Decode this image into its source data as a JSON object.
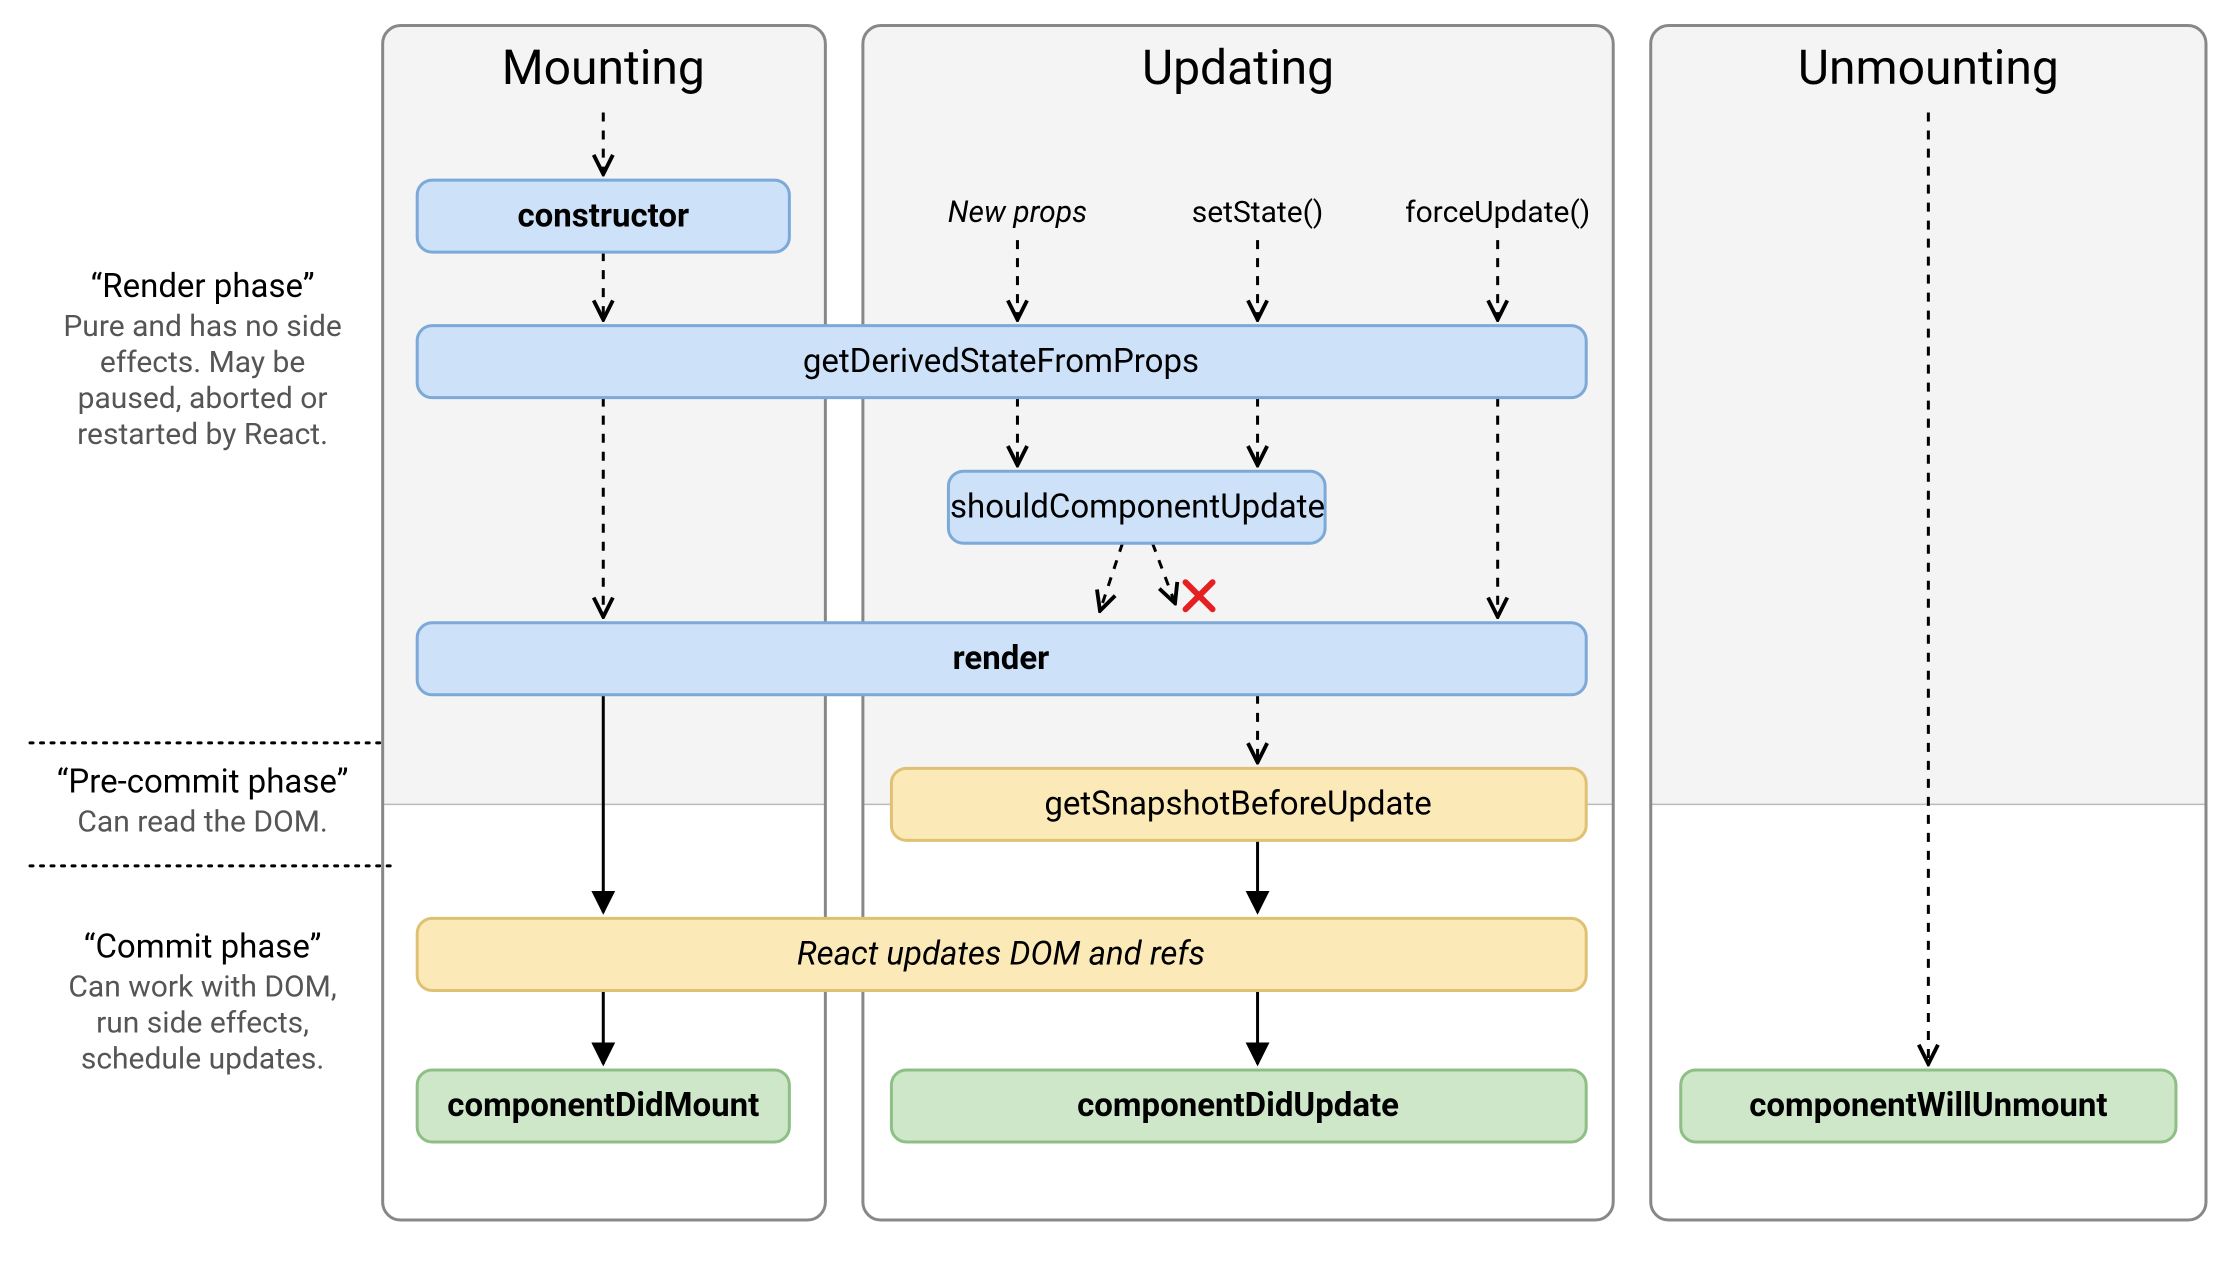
{
  "columns": {
    "mounting": "Mounting",
    "updating": "Updating",
    "unmounting": "Unmounting"
  },
  "phases": {
    "render": {
      "title": "“Render phase”",
      "desc": [
        "Pure and has no side",
        "effects. May be",
        "paused, aborted or",
        "restarted by React."
      ]
    },
    "precommit": {
      "title": "“Pre-commit phase”",
      "desc": [
        "Can read the DOM."
      ]
    },
    "commit": {
      "title": "“Commit phase”",
      "desc": [
        "Can work with DOM,",
        "run side effects,",
        "schedule updates."
      ]
    }
  },
  "triggers": {
    "newProps": "New props",
    "setState": "setState()",
    "forceUpdate": "forceUpdate()"
  },
  "methods": {
    "constructor": "constructor",
    "getDerivedStateFromProps": "getDerivedStateFromProps",
    "shouldComponentUpdate": "shouldComponentUpdate",
    "render": "render",
    "getSnapshotBeforeUpdate": "getSnapshotBeforeUpdate",
    "reactUpdates": "React updates DOM and refs",
    "componentDidMount": "componentDidMount",
    "componentDidUpdate": "componentDidUpdate",
    "componentWillUnmount": "componentWillUnmount"
  }
}
